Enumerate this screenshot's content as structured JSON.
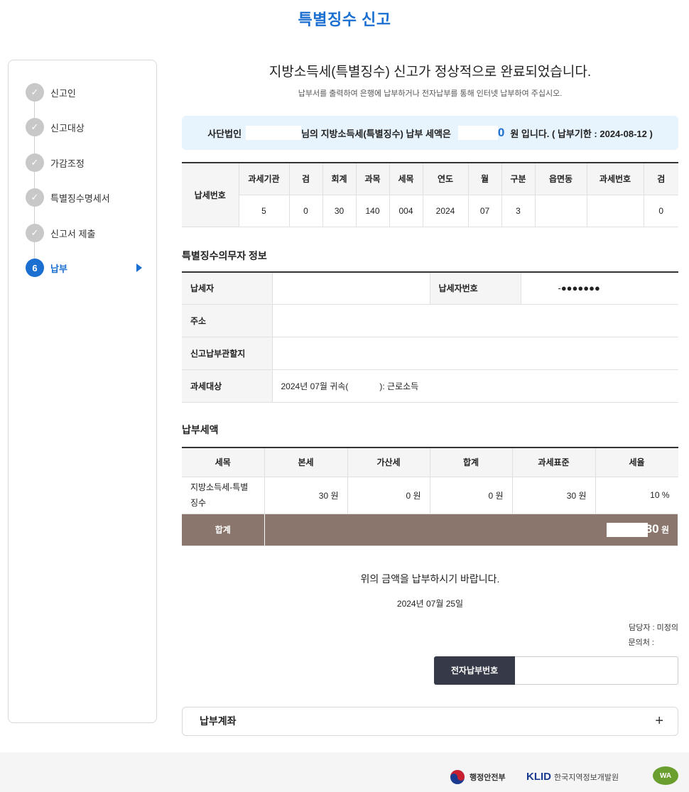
{
  "page_title": "특별징수 신고",
  "sidebar": {
    "steps": [
      {
        "num": "✓",
        "label": "신고인",
        "done": true
      },
      {
        "num": "✓",
        "label": "신고대상",
        "done": true
      },
      {
        "num": "✓",
        "label": "가감조정",
        "done": true
      },
      {
        "num": "✓",
        "label": "특별징수명세서",
        "done": true
      },
      {
        "num": "✓",
        "label": "신고서 제출",
        "done": true
      },
      {
        "num": "6",
        "label": "납부",
        "active": true
      }
    ]
  },
  "main": {
    "headline": "지방소득세(특별징수) 신고가 정상적으로 완료되었습니다.",
    "subline": "납부서를 출력하여 은행에 납부하거나 전자납부를 통해 인터넷 납부하여 주십시오.",
    "banner": {
      "prefix": "사단법인",
      "middle": "님의 지방소득세(특별징수) 납부 세액은",
      "amount": "0",
      "suffix": "원 입니다. ( 납부기한 : 2024-08-12 )"
    },
    "tax_number": {
      "row_label": "납세번호",
      "headers": [
        "과세기관",
        "검",
        "회계",
        "과목",
        "세목",
        "연도",
        "월",
        "구분",
        "읍면동",
        "과세번호",
        "검"
      ],
      "values": [
        "5",
        "0",
        "30",
        "140",
        "004",
        "2024",
        "07",
        "3",
        "",
        "",
        "0"
      ]
    },
    "obligor": {
      "title": "특별징수의무자 정보",
      "taxpayer_label": "납세자",
      "taxpayer_value": "",
      "taxpayer_no_label": "납세자번호",
      "taxpayer_no_value": "-●●●●●●●",
      "address_label": "주소",
      "address_value": "",
      "office_label": "신고납부관할지",
      "office_value": "",
      "target_label": "과세대상",
      "target_value_a": "2024년 07월 귀속(",
      "target_value_b": "): 근로소득"
    },
    "payment": {
      "title": "납부세액",
      "headers": [
        "세목",
        "본세",
        "가산세",
        "합계",
        "과세표준",
        "세율"
      ],
      "row": [
        "지방소득세-특별징수",
        "30 원",
        "0 원",
        "0 원",
        "30 원",
        "10 %"
      ],
      "total_label": "합계",
      "total_value": "30",
      "total_unit": "원"
    },
    "notice": "위의 금액을 납부하시기 바랍니다.",
    "date": "2024년 07월 25일",
    "contact_person": "담당자 : 미정의",
    "contact_phone": "문의처 :",
    "epay_label": "전자납부번호",
    "epay_value": "",
    "accordion_label": "납부계좌",
    "accordion_icon": "+"
  },
  "footer": {
    "logo1": "행정안전부",
    "logo2_brand": "KLID",
    "logo2": "한국지역정보개발원",
    "logo3": "WA"
  },
  "colors": {
    "accent": "#1a6fd1",
    "total_bg": "#8a766c",
    "banner_bg": "#e8f4fd",
    "epay_bg": "#363948"
  }
}
